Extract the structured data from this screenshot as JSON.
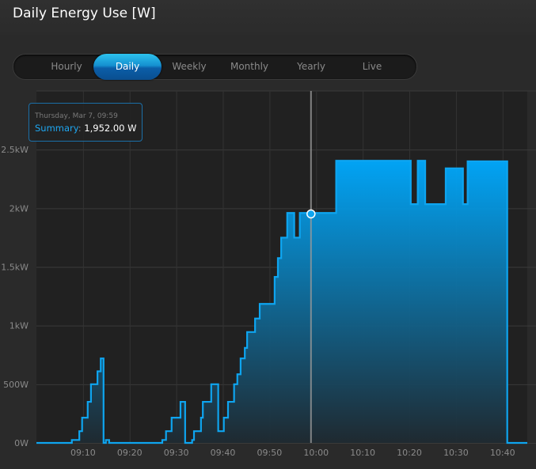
{
  "header": {
    "title": "Daily Energy Use [W]"
  },
  "tabs": [
    {
      "label": "Hourly",
      "active": false
    },
    {
      "label": "Daily",
      "active": true
    },
    {
      "label": "Weekly",
      "active": false
    },
    {
      "label": "Monthly",
      "active": false
    },
    {
      "label": "Yearly",
      "active": false
    },
    {
      "label": "Live",
      "active": false
    }
  ],
  "tooltip": {
    "date": "Thursday, Mar 7, 09:59",
    "series": "Summary",
    "sep": ":",
    "value": "1,952.00 W"
  },
  "colors": {
    "line": "#0ea5f0",
    "fill_top": "#00aaff",
    "fill_bottom": "#1f2a31",
    "grid": "#3a3a3a",
    "plot_bg": "#212121"
  },
  "chart_data": {
    "type": "area",
    "title": "Daily Energy Use [W]",
    "xlabel": "",
    "ylabel": "W",
    "x_unit": "minutes after 09:00",
    "xlim": [
      0,
      105.3
    ],
    "ylim": [
      0,
      3000
    ],
    "yticks": [
      {
        "v": 0,
        "label": "0W"
      },
      {
        "v": 500,
        "label": "500W"
      },
      {
        "v": 1000,
        "label": "1kW"
      },
      {
        "v": 1500,
        "label": "1.5kW"
      },
      {
        "v": 2000,
        "label": "2kW"
      },
      {
        "v": 2500,
        "label": "2.5kW"
      }
    ],
    "xticks": [
      {
        "v": 10,
        "label": "09:10"
      },
      {
        "v": 20,
        "label": "09:20"
      },
      {
        "v": 30,
        "label": "09:30"
      },
      {
        "v": 40,
        "label": "09:40"
      },
      {
        "v": 50,
        "label": "09:50"
      },
      {
        "v": 60,
        "label": "10:00"
      },
      {
        "v": 70,
        "label": "10:10"
      },
      {
        "v": 80,
        "label": "10:20"
      },
      {
        "v": 90,
        "label": "10:30"
      },
      {
        "v": 100,
        "label": "10:40"
      }
    ],
    "grid": true,
    "step": true,
    "hover": {
      "x": 58.9,
      "y": 1952
    },
    "series": [
      {
        "name": "Summary",
        "points": [
          [
            0,
            0
          ],
          [
            7.6,
            25
          ],
          [
            9.2,
            100
          ],
          [
            9.8,
            215
          ],
          [
            11.0,
            350
          ],
          [
            11.7,
            500
          ],
          [
            13.1,
            610
          ],
          [
            13.8,
            720
          ],
          [
            14.4,
            0
          ],
          [
            14.9,
            25
          ],
          [
            15.6,
            0
          ],
          [
            27.0,
            25
          ],
          [
            27.8,
            100
          ],
          [
            29.0,
            215
          ],
          [
            30.9,
            350
          ],
          [
            31.9,
            0
          ],
          [
            33.4,
            25
          ],
          [
            33.8,
            100
          ],
          [
            35.3,
            215
          ],
          [
            35.7,
            350
          ],
          [
            37.5,
            500
          ],
          [
            39.0,
            100
          ],
          [
            40.2,
            215
          ],
          [
            41.1,
            350
          ],
          [
            42.4,
            500
          ],
          [
            43.1,
            585
          ],
          [
            43.8,
            720
          ],
          [
            44.7,
            810
          ],
          [
            45.2,
            945
          ],
          [
            46.9,
            1060
          ],
          [
            47.9,
            1185
          ],
          [
            51.1,
            1415
          ],
          [
            51.8,
            1575
          ],
          [
            52.5,
            1750
          ],
          [
            53.8,
            1960
          ],
          [
            55.3,
            1750
          ],
          [
            56.5,
            1960
          ],
          [
            64.3,
            2405
          ],
          [
            80.3,
            2035
          ],
          [
            81.8,
            2405
          ],
          [
            83.4,
            2035
          ],
          [
            87.8,
            2340
          ],
          [
            91.5,
            2035
          ],
          [
            92.5,
            2400
          ],
          [
            101.0,
            0
          ],
          [
            105.3,
            0
          ]
        ]
      }
    ]
  }
}
